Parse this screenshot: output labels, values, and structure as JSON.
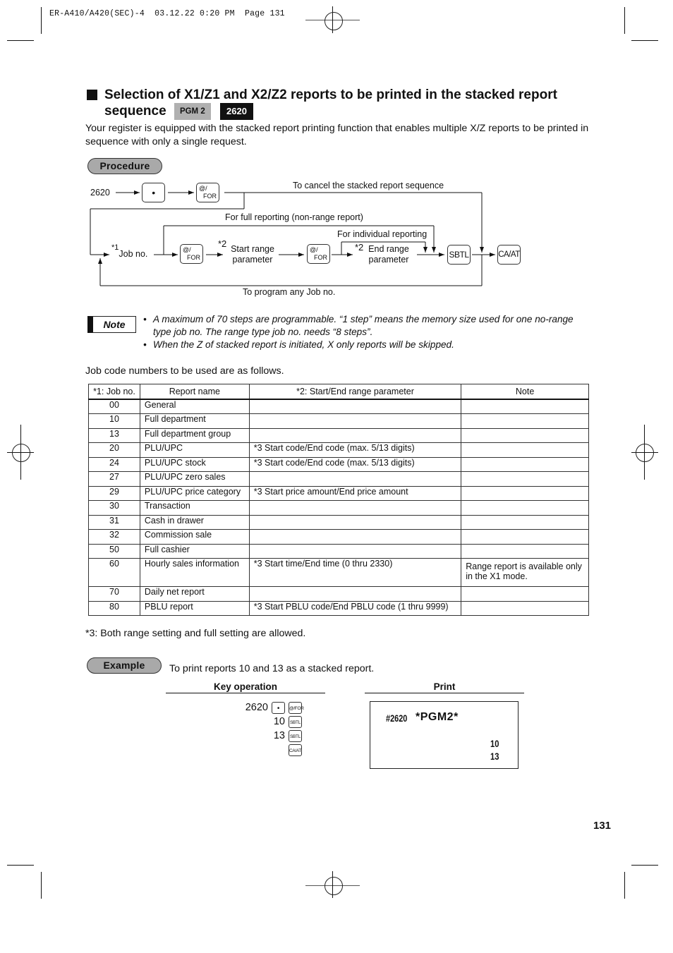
{
  "header": {
    "doc_id": "ER-A410/A420(SEC)-4",
    "date": "03.12.22",
    "time": "0:20 PM",
    "page_label": "Page 131"
  },
  "section": {
    "title_line1": "Selection of X1/Z1 and X2/Z2 reports to be printed in the stacked report",
    "title_line2": "sequence",
    "badge_mode": "PGM 2",
    "badge_code": "2620",
    "intro": "Your register is equipped with the stacked report printing function that enables multiple X/Z reports to be printed in sequence with only a single request."
  },
  "procedure": {
    "label": "Procedure",
    "start_code": "2620",
    "keys": {
      "point": "•",
      "for_top": "@/",
      "for_bottom": "FOR",
      "sbtl": "SBTL",
      "caat": "CA/AT"
    },
    "labels": {
      "cancel": "To cancel the stacked report sequence",
      "full": "For full reporting (non-range report)",
      "individual": "For individual reporting",
      "job_no_mark": "*1",
      "job_no": "Job no.",
      "start_mark": "*2",
      "start_line1": "Start range",
      "start_line2": "parameter",
      "end_mark": "*2",
      "end_line1": "End range",
      "end_line2": "parameter",
      "loop": "To program any Job no."
    }
  },
  "note": {
    "label": "Note",
    "items": [
      "A maximum of 70 steps are programmable.  “1 step” means the memory size used for one no-range type job no. The range type job no. needs “8 steps”.",
      "When the Z of stacked report is initiated, X only reports will be skipped."
    ]
  },
  "table": {
    "intro": "Job code numbers to be used are as follows.",
    "headers": [
      "*1: Job no.",
      "Report name",
      "*2: Start/End range parameter",
      "Note"
    ],
    "rows": [
      {
        "job": "00",
        "name": "General",
        "param": "",
        "note": ""
      },
      {
        "job": "10",
        "name": "Full department",
        "param": "",
        "note": ""
      },
      {
        "job": "13",
        "name": "Full department group",
        "param": "",
        "note": ""
      },
      {
        "job": "20",
        "name": "PLU/UPC",
        "param": "*3 Start code/End code (max. 5/13 digits)",
        "note": ""
      },
      {
        "job": "24",
        "name": "PLU/UPC stock",
        "param": "*3 Start code/End code (max. 5/13 digits)",
        "note": ""
      },
      {
        "job": "27",
        "name": "PLU/UPC zero sales",
        "param": "",
        "note": ""
      },
      {
        "job": "29",
        "name": "PLU/UPC price category",
        "param": "*3 Start price amount/End price amount",
        "note": ""
      },
      {
        "job": "30",
        "name": "Transaction",
        "param": "",
        "note": ""
      },
      {
        "job": "31",
        "name": "Cash in drawer",
        "param": "",
        "note": ""
      },
      {
        "job": "32",
        "name": "Commission sale",
        "param": "",
        "note": ""
      },
      {
        "job": "50",
        "name": "Full cashier",
        "param": "",
        "note": ""
      },
      {
        "job": "60",
        "name": "Hourly sales information",
        "param": "*3 Start time/End time (0 thru 2330)",
        "note": "Range report is available only in the X1 mode."
      },
      {
        "job": "70",
        "name": "Daily net report",
        "param": "",
        "note": ""
      },
      {
        "job": "80",
        "name": "PBLU report",
        "param": "*3 Start PBLU code/End PBLU code (1 thru 9999)",
        "note": ""
      }
    ],
    "footnote": "*3:  Both range setting and full setting are allowed."
  },
  "example": {
    "label": "Example",
    "description": "To print reports 10 and 13 as a stacked report.",
    "key_operation_title": "Key operation",
    "print_title": "Print",
    "key_rows": [
      {
        "value": "2620",
        "keys": [
          "•",
          "@/FOR"
        ]
      },
      {
        "value": "10",
        "keys": [
          "SBTL"
        ]
      },
      {
        "value": "13",
        "keys": [
          "SBTL"
        ]
      },
      {
        "value": "",
        "keys": [
          "CA/AT"
        ]
      }
    ],
    "receipt": {
      "code": "#2620",
      "mode": "*PGM2*",
      "lines": [
        "10",
        "13"
      ]
    }
  },
  "footer": {
    "page_number": "131"
  }
}
